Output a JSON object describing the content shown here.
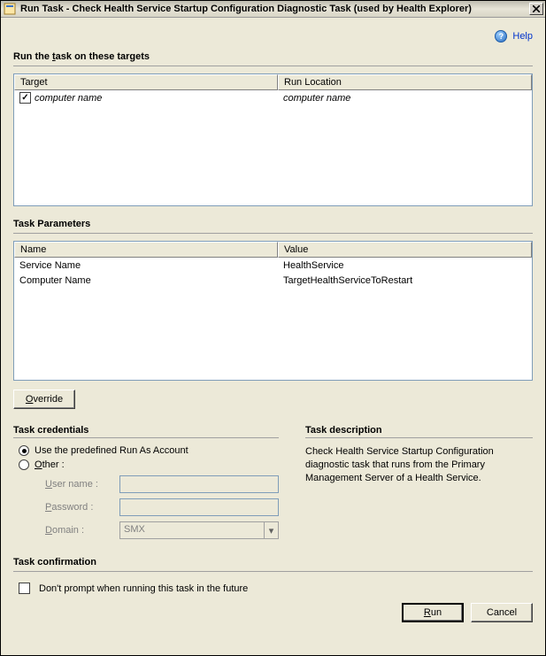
{
  "window": {
    "title": "Run Task - Check Health Service Startup Configuration Diagnostic Task (used by Health Explorer)"
  },
  "help": {
    "label": "Help"
  },
  "targets": {
    "heading": "Run the task on these targets",
    "heading_ul": "t",
    "col_target": "Target",
    "col_target_ul": "T",
    "col_location": "Run Location",
    "rows": [
      {
        "checked": true,
        "target": "computer name",
        "location": "computer name"
      }
    ]
  },
  "params": {
    "heading": "Task Parameters",
    "col_name": "Name",
    "col_value": "Value",
    "rows": [
      {
        "name": "Service Name",
        "value": "HealthService"
      },
      {
        "name": "Computer Name",
        "value": "TargetHealthServiceToRestart"
      }
    ]
  },
  "override": {
    "label": "Override",
    "ul": "O"
  },
  "credentials": {
    "heading": "Task credentials",
    "opt_predefined": "Use the predefined Run As Account",
    "opt_other": "Other :",
    "opt_other_ul": "O",
    "username_label": "User name :",
    "username_ul": "U",
    "password_label": "Password :",
    "password_ul": "P",
    "domain_label": "Domain :",
    "domain_ul": "D",
    "domain_value": "SMX"
  },
  "description": {
    "heading": "Task description",
    "text": "Check Health Service Startup Configuration diagnostic task that runs from the Primary Management Server of a Health Service."
  },
  "confirmation": {
    "heading": "Task confirmation",
    "checkbox_label": "Don't prompt when running this task in the future"
  },
  "buttons": {
    "run": "Run",
    "run_ul": "R",
    "cancel": "Cancel"
  }
}
